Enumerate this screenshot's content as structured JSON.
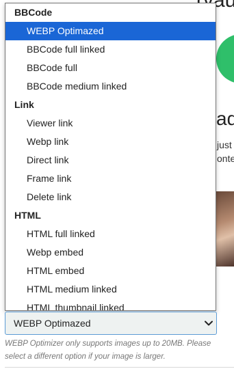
{
  "background": {
    "heading_top": "(vau",
    "heading": "ad",
    "text_line_1": "just",
    "text_line_2": "onte"
  },
  "dropdown": {
    "groups": [
      {
        "label": "BBCode",
        "options": [
          "WEBP Optimazed",
          "BBCode full linked",
          "BBCode full",
          "BBCode medium linked"
        ]
      },
      {
        "label": "Link",
        "options": [
          "Viewer link",
          "Webp link",
          "Direct link",
          "Frame link",
          "Delete link"
        ]
      },
      {
        "label": "HTML",
        "options": [
          "HTML full linked",
          "Webp embed",
          "HTML embed",
          "HTML medium linked",
          "HTML thumbnail linked"
        ]
      }
    ],
    "selected": "WEBP Optimazed"
  },
  "select": {
    "value": "WEBP Optimazed"
  },
  "help_text": "WEBP Optimizer only supports images up to 20MB. Please select a different option if your image is larger.",
  "colors": {
    "selected_bg": "#1a66d6",
    "select_border": "#5b9bd5",
    "select_bg": "#eef2f1",
    "accent_green": "#2fbf6a"
  },
  "icons": {
    "select_chevron": "chevron-down-icon"
  }
}
